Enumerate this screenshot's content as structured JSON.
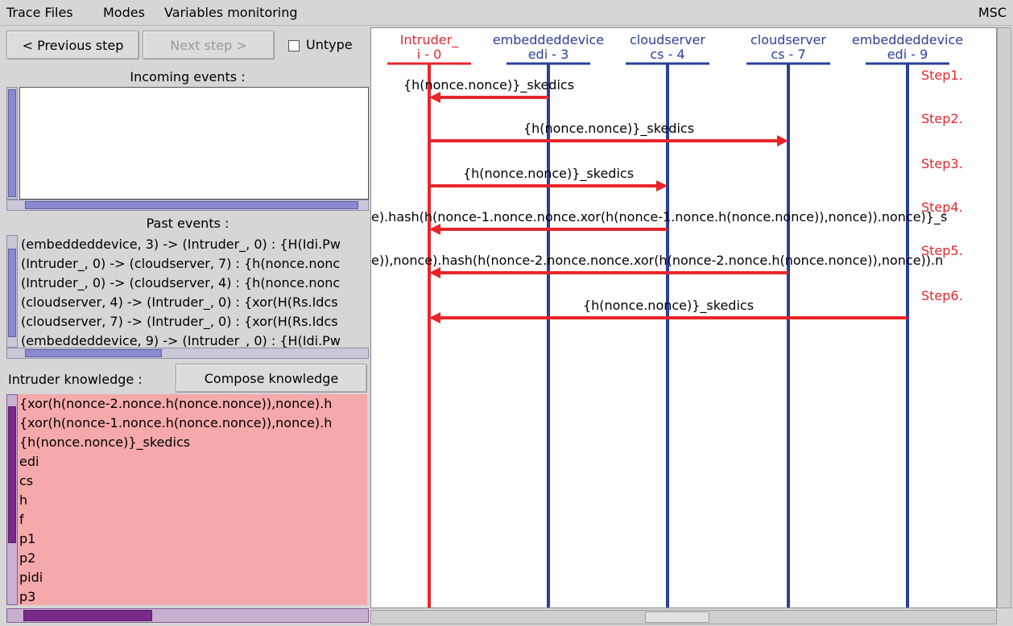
{
  "menu": {
    "trace_files": "Trace Files",
    "modes": "Modes",
    "variables_monitoring": "Variables monitoring",
    "msc": "MSC"
  },
  "controls": {
    "previous_step": "< Previous step",
    "next_step": "Next step >",
    "untype": "Untype",
    "untype_checked": false
  },
  "incoming_events": {
    "label": "Incoming events :"
  },
  "past_events": {
    "label": "Past events :",
    "items": [
      "(embeddeddevice, 3) -> (Intruder_, 0) : {H(Idi.Pw",
      "(Intruder_, 0) -> (cloudserver, 7) : {h(nonce.nonc",
      "(Intruder_, 0) -> (cloudserver, 4) : {h(nonce.nonc",
      "(cloudserver, 4) -> (Intruder_, 0) : {xor(H(Rs.Idcs",
      "(cloudserver, 7) -> (Intruder_, 0) : {xor(H(Rs.Idcs",
      "(embeddeddevice, 9) -> (Intruder_, 0) : {H(Idi.Pw"
    ]
  },
  "intruder_knowledge": {
    "label": "Intruder knowledge :",
    "compose_button": "Compose knowledge",
    "items": [
      "{xor(h(nonce-2.nonce.h(nonce.nonce)),nonce).h",
      "{xor(h(nonce-1.nonce.h(nonce.nonce)),nonce).h",
      "{h(nonce.nonce)}_skedics",
      "edi",
      "cs",
      "h",
      "f",
      "p1",
      "p2",
      "pidi",
      "p3"
    ]
  },
  "msc": {
    "colors": {
      "intruder": "#e8262a",
      "agent": "#2a4099",
      "step": "#e8262a"
    },
    "lifelines": [
      {
        "name": "Intruder_",
        "id": "i - 0",
        "role": "intruder"
      },
      {
        "name": "embeddeddevice",
        "id": "edi - 3",
        "role": "agent"
      },
      {
        "name": "cloudserver",
        "id": "cs - 4",
        "role": "agent"
      },
      {
        "name": "cloudserver",
        "id": "cs - 7",
        "role": "agent"
      },
      {
        "name": "embeddeddevice",
        "id": "edi - 9",
        "role": "agent"
      }
    ],
    "steps": [
      {
        "label": "Step1.",
        "from": 1,
        "to": 0,
        "message": "{h(nonce.nonce)}_skedics"
      },
      {
        "label": "Step2.",
        "from": 0,
        "to": 3,
        "message": "{h(nonce.nonce)}_skedics"
      },
      {
        "label": "Step3.",
        "from": 0,
        "to": 2,
        "message": "{h(nonce.nonce)}_skedics"
      },
      {
        "label": "Step4.",
        "from": 2,
        "to": 0,
        "message": "e).hash(h(nonce-1.nonce.nonce.xor(h(nonce-1.nonce.h(nonce.nonce)),nonce)).nonce)}_s"
      },
      {
        "label": "Step5.",
        "from": 3,
        "to": 0,
        "message": "e)),nonce).hash(h(nonce-2.nonce.nonce.xor(h(nonce-2.nonce.h(nonce.nonce)),nonce)).n"
      },
      {
        "label": "Step6.",
        "from": 4,
        "to": 0,
        "message": "{h(nonce.nonce)}_skedics"
      }
    ]
  }
}
